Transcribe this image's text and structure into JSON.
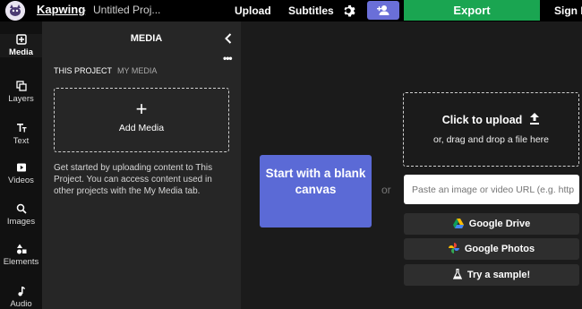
{
  "header": {
    "brand": "Kapwing",
    "separator": "›",
    "project_title": "Untitled Proj...",
    "upload_label": "Upload",
    "subtitles_label": "Subtitles",
    "export_label": "Export",
    "signin_label": "Sign In"
  },
  "sidebar": {
    "items": [
      {
        "label": "Media",
        "icon": "media-icon"
      },
      {
        "label": "Layers",
        "icon": "layers-icon"
      },
      {
        "label": "Text",
        "icon": "text-icon"
      },
      {
        "label": "Videos",
        "icon": "videos-icon"
      },
      {
        "label": "Images",
        "icon": "images-icon"
      },
      {
        "label": "Elements",
        "icon": "elements-icon"
      },
      {
        "label": "Audio",
        "icon": "audio-icon"
      }
    ]
  },
  "panel": {
    "title": "MEDIA",
    "more": "•••",
    "tabs": [
      "THIS PROJECT",
      "MY MEDIA"
    ],
    "add_media_plus": "+",
    "add_media_label": "Add Media",
    "description": "Get started by uploading content to This Project. You can access content used in other projects with the My Media tab."
  },
  "main": {
    "blank_canvas_label": "Start with a blank canvas",
    "or_label": "or",
    "upload_title": "Click to upload",
    "upload_subtitle": "or, drag and drop a file here",
    "url_placeholder": "Paste an image or video URL (e.g. http",
    "google_drive_label": "Google Drive",
    "google_photos_label": "Google Photos",
    "sample_label": "Try a sample!"
  },
  "colors": {
    "export": "#1aa551",
    "accent": "#5b6ad6",
    "invite": "#6a6fd8"
  }
}
